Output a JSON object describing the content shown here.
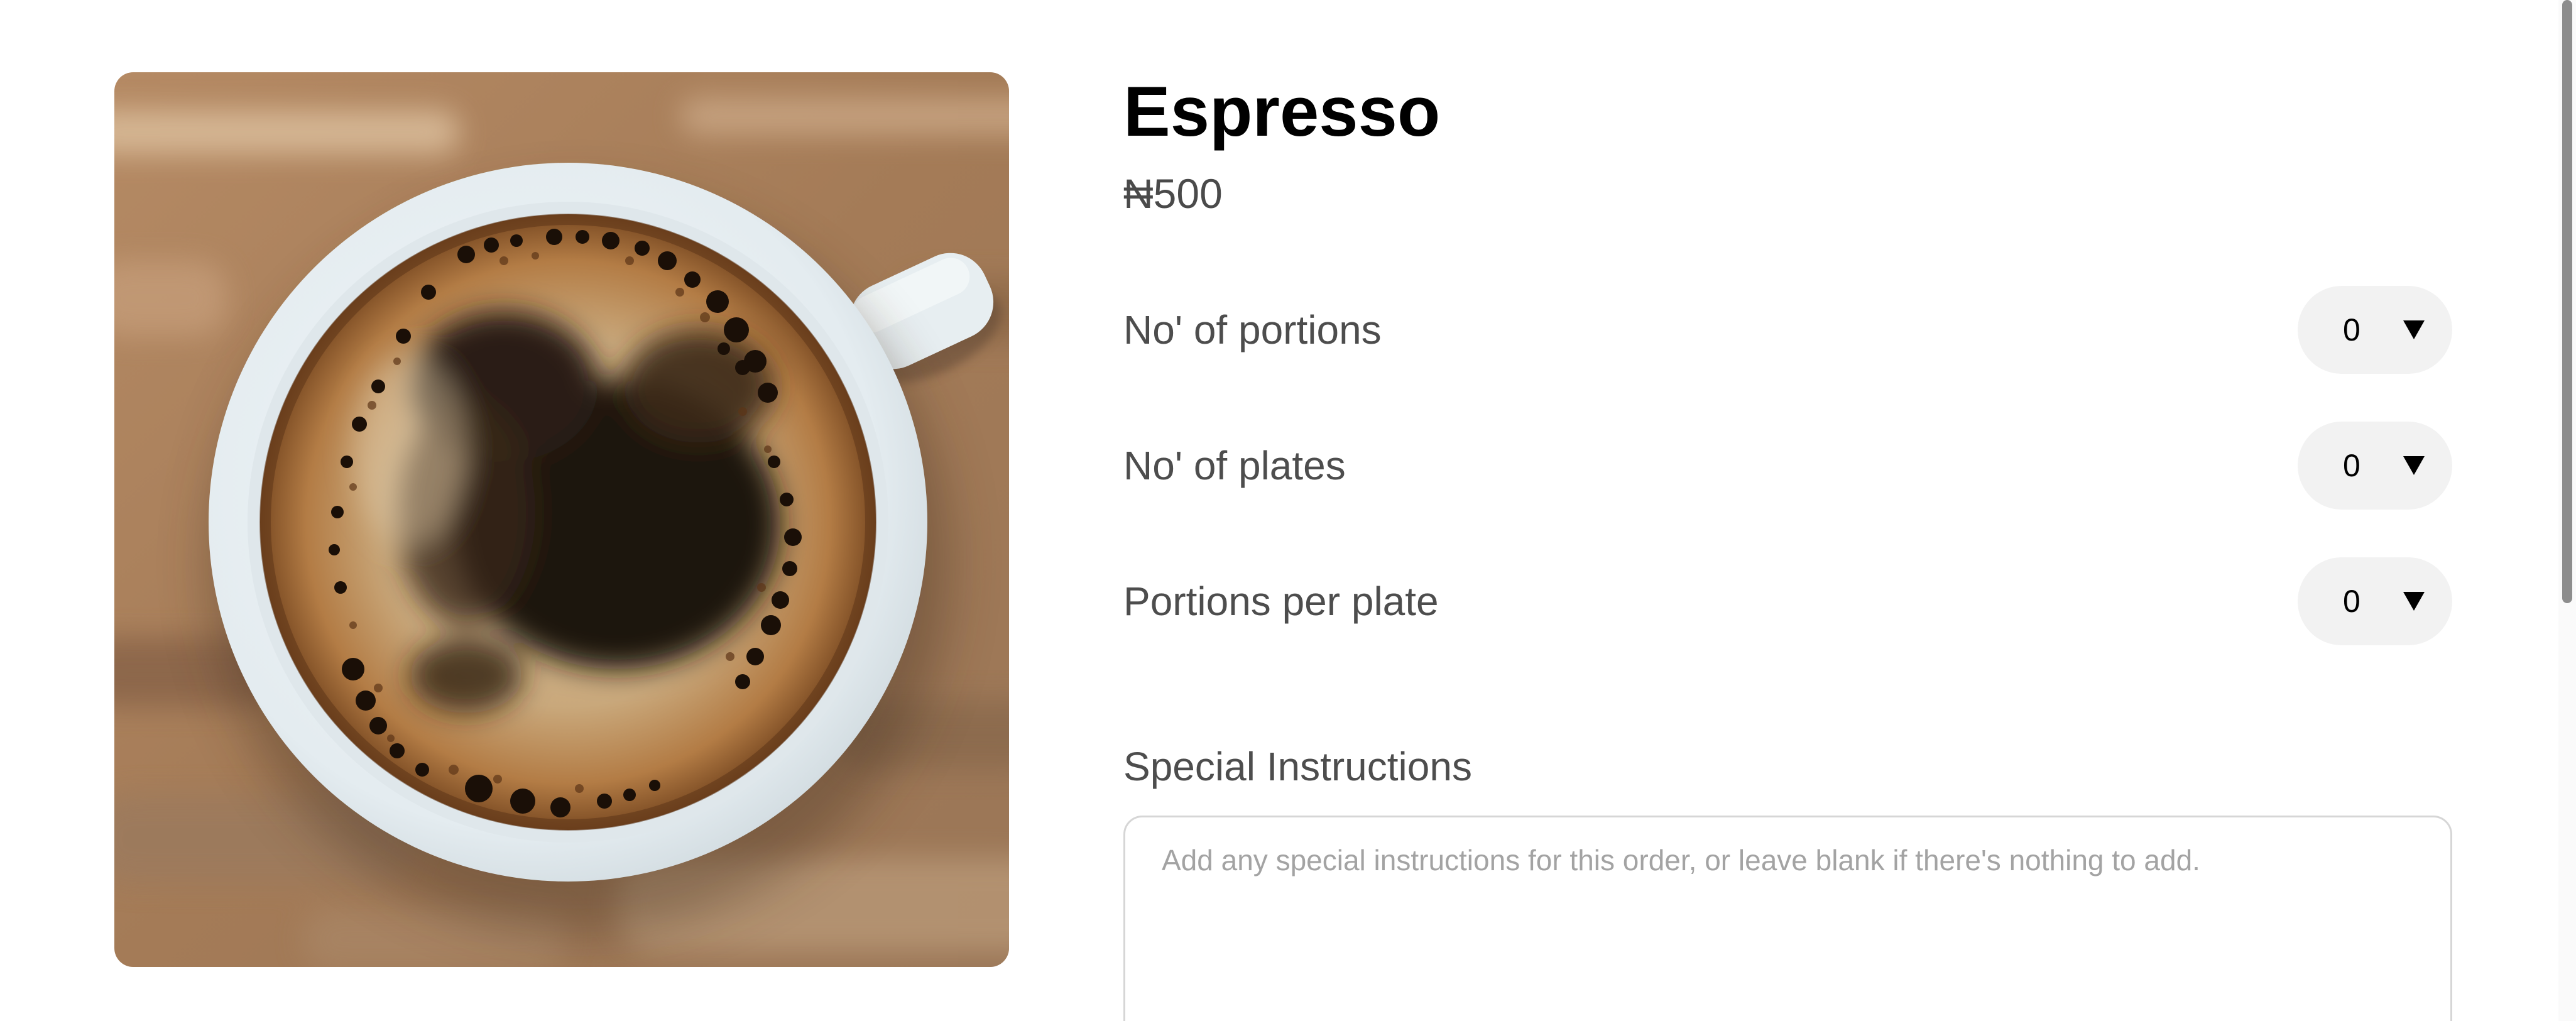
{
  "product": {
    "image_icon": "espresso-cup-photo",
    "title": "Espresso",
    "price": "₦500"
  },
  "options": [
    {
      "label": "No' of portions",
      "value": "0",
      "icon": "chevron-down-icon"
    },
    {
      "label": "No' of plates",
      "value": "0",
      "icon": "chevron-down-icon"
    },
    {
      "label": "Portions per plate",
      "value": "0",
      "icon": "chevron-down-icon"
    }
  ],
  "instructions": {
    "label": "Special Instructions",
    "placeholder": "Add any special instructions for this order, or leave blank if there's nothing to add.",
    "value": ""
  },
  "colors": {
    "title_text": "#000000",
    "label_text": "#4d4d4d",
    "select_background": "#f2f2f2",
    "field_border": "#d6d6d6",
    "placeholder_text": "#a3a3a3"
  }
}
